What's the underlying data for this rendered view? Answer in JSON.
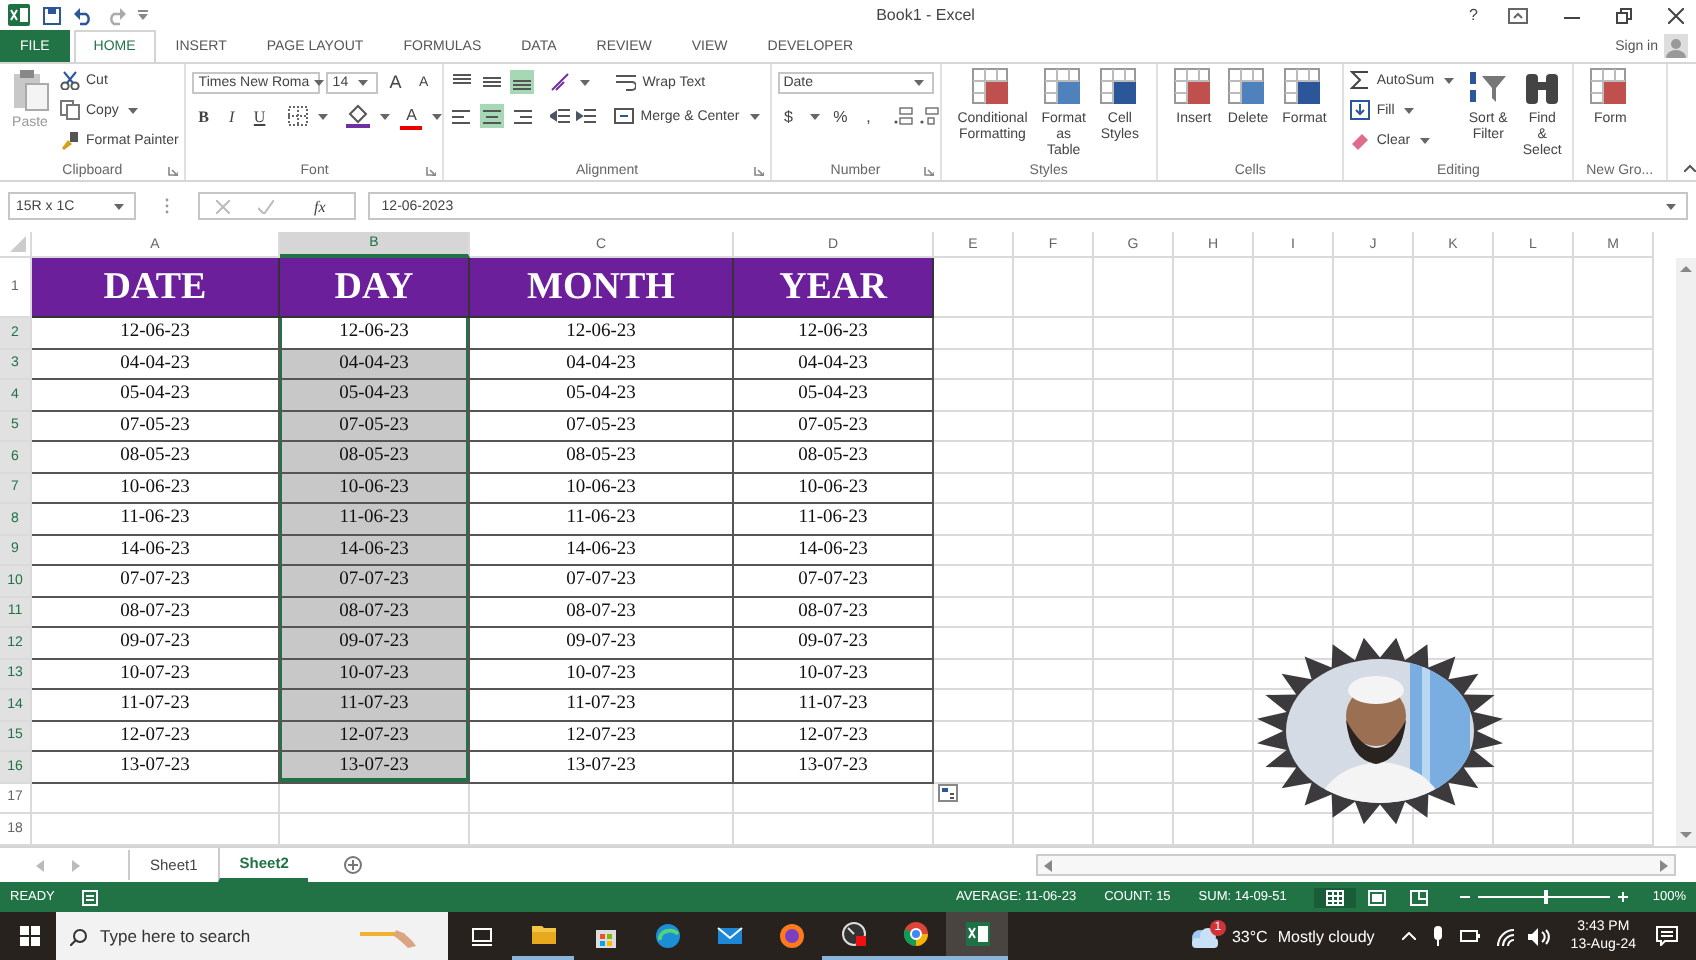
{
  "title_bar": {
    "title": "Book1 - Excel",
    "help": "?"
  },
  "tabs": [
    {
      "label": "FILE",
      "kind": "file",
      "selected": false
    },
    {
      "label": "HOME",
      "kind": "tab",
      "selected": true
    },
    {
      "label": "INSERT",
      "kind": "tab",
      "selected": false
    },
    {
      "label": "PAGE LAYOUT",
      "kind": "tab",
      "selected": false
    },
    {
      "label": "FORMULAS",
      "kind": "tab",
      "selected": false
    },
    {
      "label": "DATA",
      "kind": "tab",
      "selected": false
    },
    {
      "label": "REVIEW",
      "kind": "tab",
      "selected": false
    },
    {
      "label": "VIEW",
      "kind": "tab",
      "selected": false
    },
    {
      "label": "DEVELOPER",
      "kind": "tab",
      "selected": false
    }
  ],
  "account": {
    "label": "Sign in"
  },
  "ribbon": {
    "groups": [
      {
        "kind": "clipboard",
        "name": "Clipboard",
        "items": [
          "Paste",
          "Cut",
          "Copy",
          "Format Painter"
        ]
      },
      {
        "kind": "font",
        "name": "Font",
        "font_name": "Times New Roma",
        "font_size": "14",
        "grow": "A",
        "shrink": "A",
        "styles": [
          "B",
          "I",
          "U"
        ],
        "font_color": "A"
      },
      {
        "kind": "alignment",
        "name": "Alignment",
        "wrap": "Wrap Text",
        "merge": "Merge & Center",
        "vertical": [
          {
            "selected": false
          },
          {
            "selected": false
          },
          {
            "selected": true
          }
        ],
        "horizontal": [
          {
            "selected": false
          },
          {
            "selected": true
          },
          {
            "selected": false
          }
        ]
      },
      {
        "kind": "number",
        "name": "Number",
        "format": "Date",
        "symbols": [
          "$",
          "%",
          ","
        ]
      },
      {
        "kind": "large",
        "name": "Styles",
        "items": [
          "Conditional Formatting",
          "Format as Table",
          "Cell Styles"
        ]
      },
      {
        "kind": "large",
        "name": "Cells",
        "items": [
          "Insert",
          "Delete",
          "Format"
        ]
      },
      {
        "kind": "editing",
        "name": "Editing",
        "items": [
          "AutoSum",
          "Fill",
          "Clear"
        ],
        "large": [
          "Sort & Filter",
          "Find & Select"
        ]
      },
      {
        "kind": "large",
        "name": "New Gro...",
        "items": [
          "Form"
        ]
      }
    ]
  },
  "formula_bar": {
    "name_box": "15R x 1C",
    "fx": "fx",
    "value": "12-06-2023"
  },
  "sheet": {
    "columns": [
      {
        "label": "A",
        "selected": false
      },
      {
        "label": "B",
        "selected": true
      },
      {
        "label": "C",
        "selected": false
      },
      {
        "label": "D",
        "selected": false
      },
      {
        "label": "E",
        "selected": false
      },
      {
        "label": "F",
        "selected": false
      },
      {
        "label": "G",
        "selected": false
      },
      {
        "label": "H",
        "selected": false
      },
      {
        "label": "I",
        "selected": false
      },
      {
        "label": "J",
        "selected": false
      },
      {
        "label": "K",
        "selected": false
      },
      {
        "label": "L",
        "selected": false
      },
      {
        "label": "M",
        "selected": false
      }
    ],
    "rows": [
      {
        "header": "1",
        "kind": "title",
        "selected": false,
        "cells": [
          "DATE",
          "DAY",
          "MONTH",
          "YEAR"
        ]
      },
      {
        "header": "2",
        "kind": "data",
        "selected": true,
        "cells": [
          "12-06-23",
          "12-06-23",
          "12-06-23",
          "12-06-23"
        ]
      },
      {
        "header": "3",
        "kind": "data",
        "selected": true,
        "cells": [
          "04-04-23",
          "04-04-23",
          "04-04-23",
          "04-04-23"
        ]
      },
      {
        "header": "4",
        "kind": "data",
        "selected": true,
        "cells": [
          "05-04-23",
          "05-04-23",
          "05-04-23",
          "05-04-23"
        ]
      },
      {
        "header": "5",
        "kind": "data",
        "selected": true,
        "cells": [
          "07-05-23",
          "07-05-23",
          "07-05-23",
          "07-05-23"
        ]
      },
      {
        "header": "6",
        "kind": "data",
        "selected": true,
        "cells": [
          "08-05-23",
          "08-05-23",
          "08-05-23",
          "08-05-23"
        ]
      },
      {
        "header": "7",
        "kind": "data",
        "selected": true,
        "cells": [
          "10-06-23",
          "10-06-23",
          "10-06-23",
          "10-06-23"
        ]
      },
      {
        "header": "8",
        "kind": "data",
        "selected": true,
        "cells": [
          "11-06-23",
          "11-06-23",
          "11-06-23",
          "11-06-23"
        ]
      },
      {
        "header": "9",
        "kind": "data",
        "selected": true,
        "cells": [
          "14-06-23",
          "14-06-23",
          "14-06-23",
          "14-06-23"
        ]
      },
      {
        "header": "10",
        "kind": "data",
        "selected": true,
        "cells": [
          "07-07-23",
          "07-07-23",
          "07-07-23",
          "07-07-23"
        ]
      },
      {
        "header": "11",
        "kind": "data",
        "selected": true,
        "cells": [
          "08-07-23",
          "08-07-23",
          "08-07-23",
          "08-07-23"
        ]
      },
      {
        "header": "12",
        "kind": "data",
        "selected": true,
        "cells": [
          "09-07-23",
          "09-07-23",
          "09-07-23",
          "09-07-23"
        ]
      },
      {
        "header": "13",
        "kind": "data",
        "selected": true,
        "cells": [
          "10-07-23",
          "10-07-23",
          "10-07-23",
          "10-07-23"
        ]
      },
      {
        "header": "14",
        "kind": "data",
        "selected": true,
        "cells": [
          "11-07-23",
          "11-07-23",
          "11-07-23",
          "11-07-23"
        ]
      },
      {
        "header": "15",
        "kind": "data",
        "selected": true,
        "cells": [
          "12-07-23",
          "12-07-23",
          "12-07-23",
          "12-07-23"
        ]
      },
      {
        "header": "16",
        "kind": "data",
        "selected": true,
        "cells": [
          "13-07-23",
          "13-07-23",
          "13-07-23",
          "13-07-23"
        ]
      },
      {
        "header": "17",
        "kind": "empty",
        "selected": false
      },
      {
        "header": "18",
        "kind": "empty",
        "selected": false
      }
    ]
  },
  "sheet_tabs": [
    {
      "label": "Sheet1",
      "selected": false
    },
    {
      "label": "Sheet2",
      "selected": true
    }
  ],
  "status_bar": {
    "mode": "READY",
    "stats": [
      "AVERAGE: 11-06-23",
      "COUNT: 15",
      "SUM: 14-09-51"
    ],
    "views": [
      {
        "selected": true
      },
      {
        "selected": false
      },
      {
        "selected": false
      }
    ],
    "zoom": {
      "level": 0.5,
      "reading": "100%"
    }
  },
  "taskbar": {
    "search": {
      "placeholder": "Type here to search"
    },
    "apps": [
      {
        "running": true,
        "active": false
      },
      {
        "running": false,
        "active": false
      },
      {
        "running": false,
        "active": false
      },
      {
        "running": false,
        "active": false
      },
      {
        "running": false,
        "active": false
      },
      {
        "running": true,
        "active": false
      },
      {
        "running": true,
        "active": false
      },
      {
        "running": true,
        "active": true
      }
    ],
    "weather": {
      "badge": "1",
      "temperature": "33°C",
      "condition": "Mostly cloudy"
    },
    "clock": {
      "time": "3:43 PM",
      "date": "13-Aug-24"
    }
  }
}
